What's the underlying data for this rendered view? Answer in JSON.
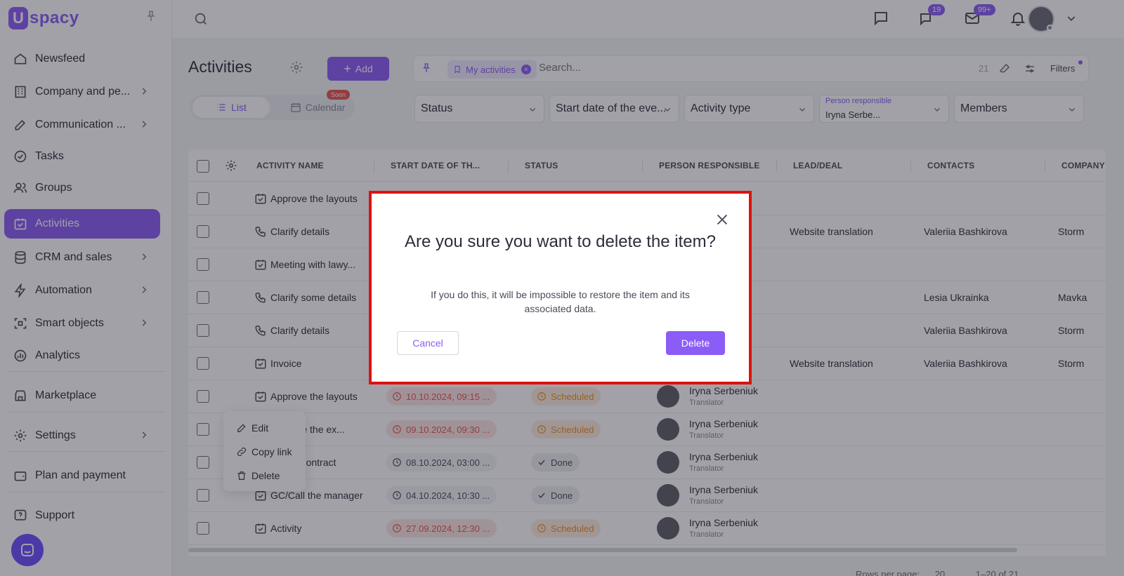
{
  "brand": {
    "logo_letter": "U",
    "logo_text": "spacy",
    "accent": "#8b5cf6"
  },
  "sidebar": {
    "items": [
      {
        "label": "Newsfeed"
      },
      {
        "label": "Company and pe..."
      },
      {
        "label": "Communication ..."
      },
      {
        "label": "Tasks"
      },
      {
        "label": "Groups"
      },
      {
        "label": "Activities"
      },
      {
        "label": "CRM and sales"
      },
      {
        "label": "Automation"
      },
      {
        "label": "Smart objects"
      },
      {
        "label": "Analytics"
      },
      {
        "label": "Marketplace"
      },
      {
        "label": "Settings"
      },
      {
        "label": "Plan and payment"
      },
      {
        "label": "Support"
      }
    ]
  },
  "topbar": {
    "chat_badge": "19",
    "mail_badge": "99+"
  },
  "header": {
    "title": "Activities",
    "add_label": "Add",
    "view_list": "List",
    "view_calendar": "Calendar",
    "soon_badge": "Soon"
  },
  "filterbar": {
    "chip": "My activities",
    "search_placeholder": "Search...",
    "count": "21",
    "filters_label": "Filters"
  },
  "selects": {
    "status": "Status",
    "start_date": "Start date of the eve...",
    "activity_type": "Activity type",
    "person_label": "Person responsible",
    "person_value": "Iryna Serbe...",
    "members": "Members"
  },
  "table": {
    "columns": [
      "ACTIVITY NAME",
      "START DATE OF TH...",
      "STATUS",
      "PERSON RESPONSIBLE",
      "LEAD/DEAL",
      "CONTACTS",
      "COMPANY"
    ],
    "rows": [
      {
        "name": "Approve the layouts",
        "icon": "calendar-check-icon",
        "date": "",
        "status": "",
        "person": "",
        "role": "",
        "lead": "",
        "contact": "",
        "company": ""
      },
      {
        "name": "Clarify details",
        "icon": "phone-icon",
        "date": "",
        "status": "",
        "person": "",
        "role": "",
        "lead": "Website translation",
        "contact": "Valeriia Bashkirova",
        "company": "Storm"
      },
      {
        "name": "Meeting with lawy...",
        "icon": "calendar-check-icon",
        "date": "",
        "status": "",
        "person": "",
        "role": "",
        "lead": "",
        "contact": "",
        "company": ""
      },
      {
        "name": "Clarify some details",
        "icon": "phone-icon",
        "date": "",
        "status": "",
        "person": "",
        "role": "",
        "lead": "",
        "contact": "Lesia Ukrainka",
        "company": "Mavka"
      },
      {
        "name": "Clarify details",
        "icon": "phone-icon",
        "date": "",
        "status": "",
        "person": "",
        "role": "",
        "lead": "",
        "contact": "Valeriia Bashkirova",
        "company": "Storm"
      },
      {
        "name": "Invoice",
        "icon": "calendar-check-icon",
        "date": "",
        "status": "",
        "person": "",
        "role": "",
        "lead": "Website translation",
        "contact": "Valeriia Bashkirova",
        "company": "Storm"
      },
      {
        "name": "Approve the layouts",
        "icon": "calendar-check-icon",
        "date": "10.10.2024, 09:15 ...",
        "date_state": "late",
        "status": "Scheduled",
        "status_state": "sched",
        "person": "Iryna Serbeniuk",
        "role": "Translator",
        "lead": "",
        "contact": "",
        "company": ""
      },
      {
        "name": "Approve the ex...",
        "icon": "calendar-check-icon",
        "date": "09.10.2024, 09:30 ...",
        "date_state": "late",
        "status": "Scheduled",
        "status_state": "sched",
        "person": "Iryna Serbeniuk",
        "role": "Translator",
        "lead": "",
        "contact": "",
        "company": ""
      },
      {
        "name": "Sign a contract",
        "icon": "calendar-check-icon",
        "date": "08.10.2024, 03:00 ...",
        "date_state": "ok",
        "status": "Done",
        "status_state": "done",
        "person": "Iryna Serbeniuk",
        "role": "Translator",
        "lead": "",
        "contact": "",
        "company": ""
      },
      {
        "name": "GC/Call the manager",
        "icon": "calendar-check-icon",
        "date": "04.10.2024, 10:30 ...",
        "date_state": "ok",
        "status": "Done",
        "status_state": "done",
        "person": "Iryna Serbeniuk",
        "role": "Translator",
        "lead": "",
        "contact": "",
        "company": ""
      },
      {
        "name": "Activity",
        "icon": "calendar-check-icon",
        "date": "27.09.2024, 12:30 ...",
        "date_state": "late",
        "status": "Scheduled",
        "status_state": "sched",
        "person": "Iryna Serbeniuk",
        "role": "Translator",
        "lead": "",
        "contact": "",
        "company": ""
      }
    ]
  },
  "footer": {
    "rows_per_page": "Rows per page:",
    "per_page_value": "20",
    "range": "1–20 of 21"
  },
  "context_menu": {
    "edit": "Edit",
    "copy_link": "Copy link",
    "delete": "Delete"
  },
  "modal": {
    "title": "Are you sure you want to delete the item?",
    "text": "If you do this, it will be impossible to restore the item and its associated data.",
    "cancel": "Cancel",
    "delete": "Delete"
  }
}
